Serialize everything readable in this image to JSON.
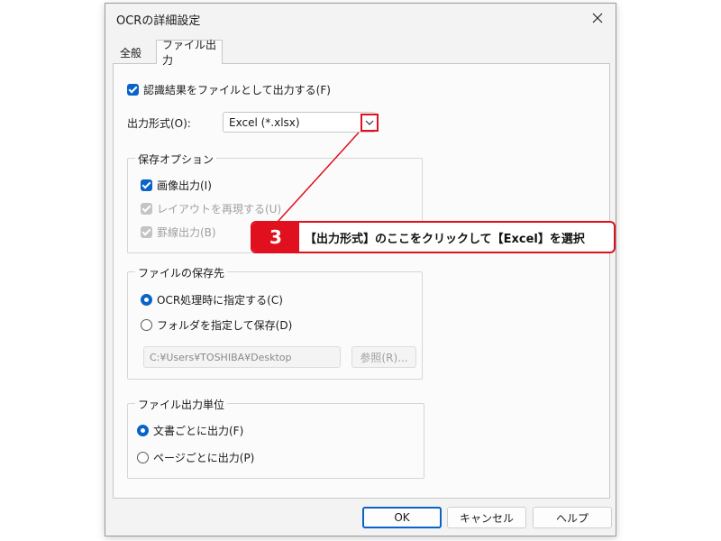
{
  "dialog": {
    "title": "OCRの詳細設定",
    "tabs": [
      {
        "label": "全般",
        "active": false
      },
      {
        "label": "ファイル出力",
        "active": true
      }
    ]
  },
  "file_output": {
    "output_to_file": {
      "label": "認識結果をファイルとして出力する(F)",
      "checked": true
    },
    "format": {
      "label": "出力形式(O):",
      "value": "Excel (*.xlsx)"
    },
    "save_options": {
      "legend": "保存オプション",
      "items": [
        {
          "label": "画像出力(I)",
          "checked": true,
          "enabled": true
        },
        {
          "label": "レイアウトを再現する(U)",
          "checked": true,
          "enabled": false
        },
        {
          "label": "罫線出力(B)",
          "checked": true,
          "enabled": false
        }
      ]
    },
    "save_location": {
      "legend": "ファイルの保存先",
      "options": [
        {
          "label": "OCR処理時に指定する(C)",
          "selected": true
        },
        {
          "label": "フォルダを指定して保存(D)",
          "selected": false
        }
      ],
      "path": "C:¥Users¥TOSHIBA¥Desktop",
      "browse_label": "参照(R)..."
    },
    "output_unit": {
      "legend": "ファイル出力単位",
      "options": [
        {
          "label": "文書ごとに出力(F)",
          "selected": true
        },
        {
          "label": "ページごとに出力(P)",
          "selected": false
        }
      ]
    }
  },
  "buttons": {
    "ok": "OK",
    "cancel": "キャンセル",
    "help": "ヘルプ"
  },
  "callout": {
    "number": "3",
    "text": "【出力形式】のここをクリックして【Excel】を選択"
  },
  "colors": {
    "accent": "#0a63c9",
    "annotation": "#e0101e"
  }
}
